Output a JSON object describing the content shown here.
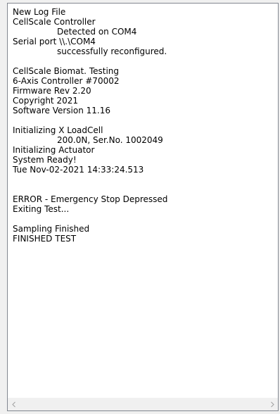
{
  "log": {
    "lines": [
      {
        "text": "New Log File",
        "indent": false
      },
      {
        "text": "CellScale Controller",
        "indent": false
      },
      {
        "text": "Detected on COM4",
        "indent": true
      },
      {
        "text": "Serial port \\\\.\\COM4",
        "indent": false
      },
      {
        "text": "successfully reconfigured.",
        "indent": true
      },
      {
        "text": "",
        "indent": false
      },
      {
        "text": "CellScale Biomat. Testing",
        "indent": false
      },
      {
        "text": "6-Axis Controller #70002",
        "indent": false
      },
      {
        "text": "Firmware Rev 2.20",
        "indent": false
      },
      {
        "text": "Copyright 2021",
        "indent": false
      },
      {
        "text": "Software Version 11.16",
        "indent": false
      },
      {
        "text": "",
        "indent": false
      },
      {
        "text": "Initializing X LoadCell",
        "indent": false
      },
      {
        "text": "200.0N, Ser.No. 1002049",
        "indent": true
      },
      {
        "text": "Initializing Actuator",
        "indent": false
      },
      {
        "text": "System Ready!",
        "indent": false
      },
      {
        "text": "Tue Nov-02-2021 14:33:24.513",
        "indent": false
      },
      {
        "text": "",
        "indent": false
      },
      {
        "text": "",
        "indent": false
      },
      {
        "text": "ERROR - Emergency Stop Depressed",
        "indent": false
      },
      {
        "text": "Exiting Test...",
        "indent": false
      },
      {
        "text": "",
        "indent": false
      },
      {
        "text": "Sampling Finished",
        "indent": false
      },
      {
        "text": "FINISHED TEST",
        "indent": false
      }
    ]
  },
  "scrollbar": {
    "left_icon": "chevron-left-icon",
    "right_icon": "chevron-right-icon",
    "arrow_color": "#a0a0a0"
  }
}
